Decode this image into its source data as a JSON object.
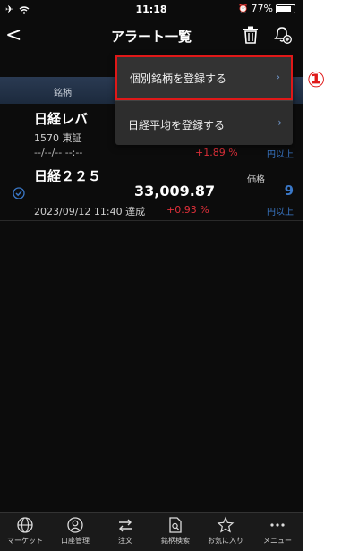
{
  "status_bar": {
    "left": "✈ ",
    "time": "11:18",
    "alarm": "⏰",
    "battery": "77%"
  },
  "nav": {
    "back": "<",
    "title": "アラート一覧"
  },
  "column_header": {
    "brand_label": "銘柄"
  },
  "rows": [
    {
      "name": "日経レバ",
      "code_market": "1570  東証",
      "date": "--/--/-- --:--",
      "change_pct": "+1.89 %",
      "unit": "円以上"
    },
    {
      "name": "日経２２５",
      "price_label": "価格",
      "price": "33,009.87",
      "target": "9",
      "date_status": "2023/09/12 11:40 達成",
      "change_pct": "+0.93 %",
      "unit": "円以上"
    }
  ],
  "dropdown": {
    "items": [
      {
        "label": "個別銘柄を登録する",
        "chevron": "›"
      },
      {
        "label": "日経平均を登録する",
        "chevron": "›"
      }
    ]
  },
  "annotation": {
    "marker": "①",
    "color": "#e01818"
  },
  "tab_bar": {
    "items": [
      {
        "label": "マーケット",
        "icon": "globe-icon"
      },
      {
        "label": "口座管理",
        "icon": "person-icon"
      },
      {
        "label": "注文",
        "icon": "arrows-icon"
      },
      {
        "label": "銘柄検索",
        "icon": "document-search-icon"
      },
      {
        "label": "お気に入り",
        "icon": "star-icon"
      },
      {
        "label": "メニュー",
        "icon": "more-icon"
      }
    ]
  },
  "colors": {
    "background": "#0c0c0c",
    "accent_blue": "#3a78c8",
    "positive_red": "#e0303a",
    "menu_bg": "#2d2d2d"
  }
}
